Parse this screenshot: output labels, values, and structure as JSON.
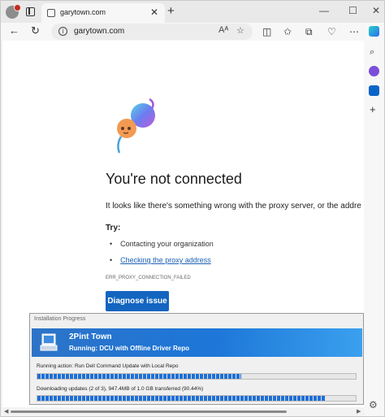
{
  "browser": {
    "tab_title": "garytown.com",
    "url": "garytown.com",
    "read_aloud_label": "Aᴬ"
  },
  "error_page": {
    "headline": "You're not connected",
    "description": "It looks like there's something wrong with the proxy server, or the addre",
    "try_label": "Try:",
    "suggestions": [
      "Contacting your organization",
      "Checking the proxy address"
    ],
    "error_code": "ERR_PROXY_CONNECTION_FAILED",
    "diagnose_button": "Diagnose issue"
  },
  "progress_dialog": {
    "title": "Installation Progress",
    "banner_title": "2Pint Town",
    "banner_subtitle": "Running: DCU with Offline Driver Repo",
    "action_text": "Running action: Run Dell Command Update with Local Repo",
    "action_progress": 0.64,
    "download_text": "Downloading updates (2 of 3), 947.4MB of 1.0 GB transferred (90.44%)",
    "download_progress": 0.9044
  },
  "colors": {
    "accent": "#1365c0",
    "banner": "#1d76d8",
    "progress": "#1f6fd6"
  }
}
